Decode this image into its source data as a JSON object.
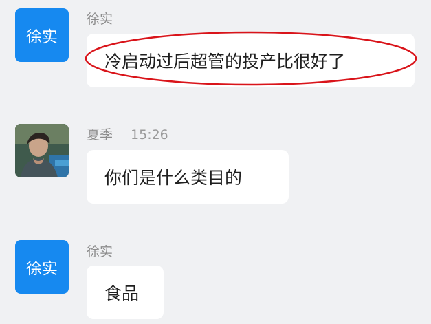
{
  "messages": [
    {
      "avatar_text": "徐实",
      "sender": "徐实",
      "time": "",
      "text": "冷启动过后超管的投产比很好了"
    },
    {
      "avatar_text": "",
      "sender": "夏季",
      "time": "15:26",
      "text": "你们是什么类目的"
    },
    {
      "avatar_text": "徐实",
      "sender": "徐实",
      "time": "",
      "text": "食品"
    }
  ],
  "colors": {
    "avatar_bg": "#1689f0",
    "highlight_ellipse": "#d9141a",
    "background": "#f0f1f3"
  }
}
